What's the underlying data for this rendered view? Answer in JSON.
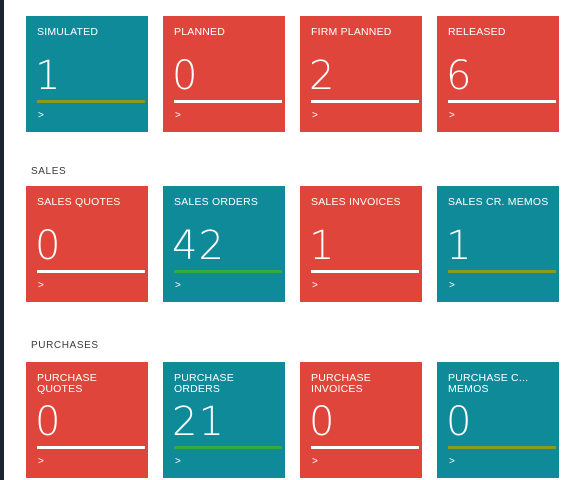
{
  "groups": {
    "production": {
      "tiles": [
        {
          "label": "SIMULATED",
          "count": "1",
          "color": "#0e8a99",
          "bar_color": "#8a9a1e"
        },
        {
          "label": "PLANNED",
          "count": "0",
          "color": "#e0453c",
          "bar_color": "#ffffff"
        },
        {
          "label": "FIRM PLANNED",
          "count": "2",
          "color": "#e0453c",
          "bar_color": "#ffffff"
        },
        {
          "label": "RELEASED",
          "count": "6",
          "color": "#e0453c",
          "bar_color": "#ffffff"
        }
      ]
    },
    "sales": {
      "title": "SALES",
      "tiles": [
        {
          "label": "SALES QUOTES",
          "count": "0",
          "color": "#e0453c",
          "bar_color": "#ffffff"
        },
        {
          "label": "SALES ORDERS",
          "count": "42",
          "color": "#0e8a99",
          "bar_color": "#3aa83a"
        },
        {
          "label": "SALES INVOICES",
          "count": "1",
          "color": "#e0453c",
          "bar_color": "#ffffff"
        },
        {
          "label": "SALES CR. MEMOS",
          "count": "1",
          "color": "#0e8a99",
          "bar_color": "#8a9a1e"
        }
      ]
    },
    "purchases": {
      "title": "PURCHASES",
      "tiles": [
        {
          "label": "PURCHASE QUOTES",
          "count": "0",
          "color": "#e0453c",
          "bar_color": "#ffffff"
        },
        {
          "label": "PURCHASE ORDERS",
          "count": "21",
          "color": "#0e8a99",
          "bar_color": "#3aa83a"
        },
        {
          "label": "PURCHASE INVOICES",
          "count": "0",
          "color": "#e0453c",
          "bar_color": "#ffffff"
        },
        {
          "label": "PURCHASE C... MEMOS",
          "count": "0",
          "color": "#0e8a99",
          "bar_color": "#8a9a1e"
        }
      ]
    }
  },
  "drilldown_glyph": ">"
}
